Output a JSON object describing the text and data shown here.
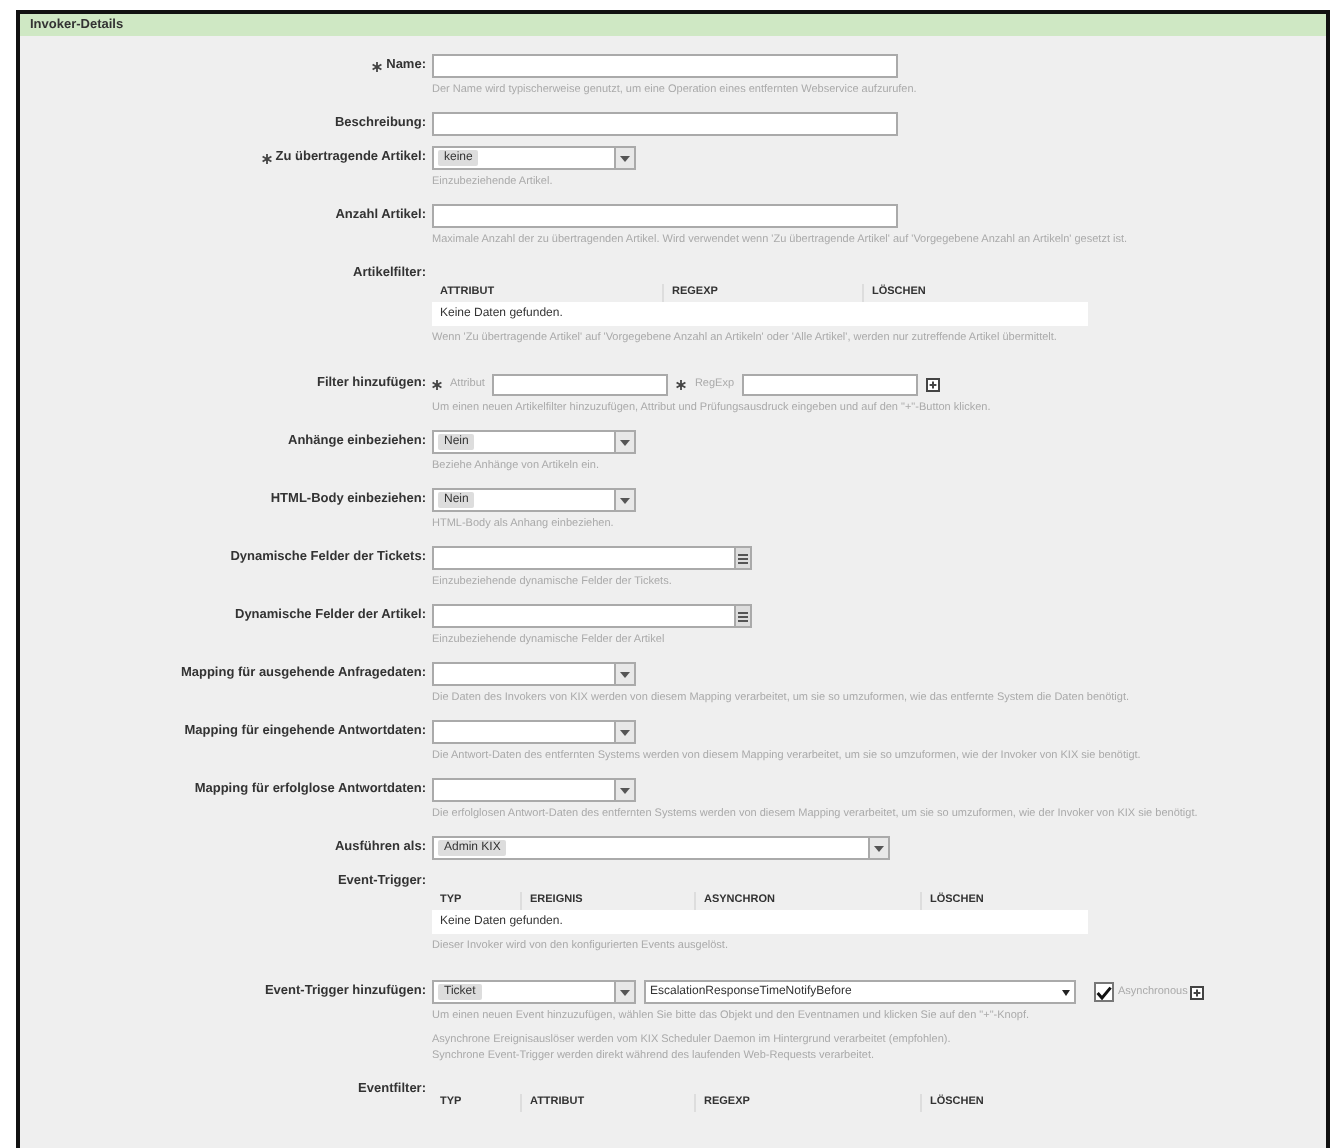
{
  "panel": {
    "title": "Invoker-Details"
  },
  "fields": [
    {
      "kind": "text",
      "label": "Name:",
      "required": true,
      "hints": [
        "Der Name wird typischerweise genutzt, um eine Operation eines entfernten Webservice aufzurufen."
      ]
    },
    {
      "kind": "text",
      "label": "Beschreibung:"
    },
    {
      "kind": "select",
      "label": "Zu übertragende Artikel:",
      "required": true,
      "value": "keine",
      "hints": [
        "Einzubeziehende Artikel."
      ]
    },
    {
      "kind": "text",
      "label": "Anzahl Artikel:",
      "hints": [
        "Maximale Anzahl der zu übertragenden Artikel. Wird verwendet wenn 'Zu übertragende Artikel' auf 'Vorgegebene Anzahl an Artikeln' gesetzt ist."
      ]
    },
    {
      "kind": "table",
      "label": "Artikelfilter:",
      "columns": [
        "ATTRIBUT",
        "REGEXP",
        "LÖSCHEN"
      ],
      "empty": "Keine Daten gefunden.",
      "hints": [
        "Wenn 'Zu übertragende Artikel' auf 'Vorgegebene Anzahl an Artikeln' oder 'Alle Artikel', werden nur zutreffende Artikel übermittelt."
      ]
    },
    {
      "kind": "filter",
      "label": "Filter hinzufügen:",
      "inputs": [
        {
          "label": "Attribut",
          "required": true
        },
        {
          "label": "RegExp",
          "required": true
        }
      ],
      "hints": [
        "Um einen neuen Artikelfilter hinzuzufügen, Attribut und Prüfungsausdruck eingeben und auf den \"+\"-Button klicken."
      ]
    },
    {
      "kind": "select",
      "label": "Anhänge einbeziehen:",
      "value": "Nein",
      "hints": [
        "Beziehe Anhänge von Artikeln ein."
      ]
    },
    {
      "kind": "select",
      "label": "HTML-Body einbeziehen:",
      "value": "Nein",
      "hints": [
        "HTML-Body als Anhang einbeziehen."
      ]
    },
    {
      "kind": "multi",
      "label": "Dynamische Felder der Tickets:",
      "hints": [
        "Einzubeziehende dynamische Felder der Tickets."
      ]
    },
    {
      "kind": "multi",
      "label": "Dynamische Felder der Artikel:",
      "hints": [
        "Einzubeziehende dynamische Felder der Artikel"
      ]
    },
    {
      "kind": "select",
      "label": "Mapping für ausgehende Anfragedaten:",
      "hints": [
        "Die Daten des Invokers von KIX werden von diesem Mapping verarbeitet, um sie so umzuformen, wie das entfernte System die Daten benötigt."
      ]
    },
    {
      "kind": "select",
      "label": "Mapping für eingehende Antwortdaten:",
      "hints": [
        "Die Antwort-Daten des entfernten Systems werden von diesem Mapping verarbeitet, um sie so umzuformen, wie der Invoker von KIX sie benötigt."
      ]
    },
    {
      "kind": "select",
      "label": "Mapping für erfolglose Antwortdaten:",
      "hints": [
        "Die erfolglosen Antwort-Daten des entfernten Systems werden von diesem Mapping verarbeitet, um sie so umzuformen, wie der Invoker von KIX sie benötigt."
      ]
    },
    {
      "kind": "select",
      "label": "Ausführen als:",
      "value": "Admin KIX",
      "wide": true
    },
    {
      "kind": "table",
      "label": "Event-Trigger:",
      "columns": [
        "TYP",
        "EREIGNIS",
        "ASYNCHRON",
        "LÖSCHEN"
      ],
      "empty": "Keine Daten gefunden.",
      "hints": [
        "Dieser Invoker wird von den konfigurierten Events ausgelöst."
      ]
    },
    {
      "kind": "event",
      "label": "Event-Trigger hinzufügen:",
      "object": "Ticket",
      "event": "EscalationResponseTimeNotifyBefore",
      "async_label": "Asynchronous",
      "checked": true,
      "hints": [
        "Um einen neuen Event hinzuzufügen, wählen Sie bitte das Objekt und den Eventnamen und klicken Sie auf den \"+\"-Knopf.",
        "Asynchrone Ereignisauslöser werden vom KIX Scheduler Daemon im Hintergrund verarbeitet (empfohlen).",
        "Synchrone Event-Trigger werden direkt während des laufenden Web-Requests verarbeitet."
      ]
    },
    {
      "kind": "table",
      "label": "Eventfilter:",
      "columns": [
        "TYP",
        "ATTRIBUT",
        "REGEXP",
        "LÖSCHEN"
      ]
    }
  ]
}
